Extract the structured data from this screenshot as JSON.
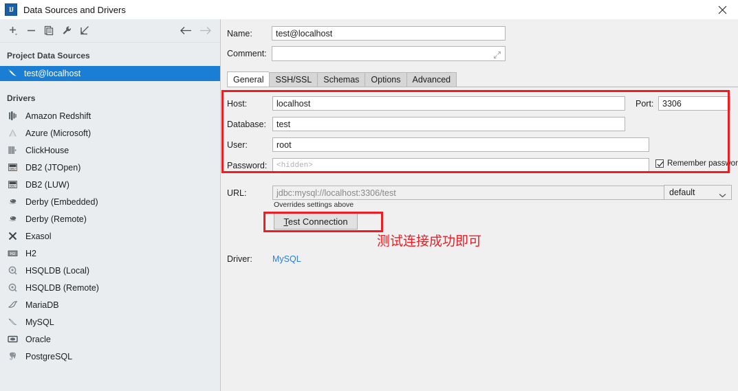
{
  "window": {
    "title": "Data Sources and Drivers",
    "app_icon": "intellij-idea-icon",
    "close_label": "×"
  },
  "toolbar": {
    "buttons": [
      {
        "name": "add-button",
        "icon": "plus-icon",
        "tooltip": "Add"
      },
      {
        "name": "remove-button",
        "icon": "minus-icon",
        "tooltip": "Remove"
      },
      {
        "name": "duplicate-button",
        "icon": "copy-icon",
        "tooltip": "Duplicate"
      },
      {
        "name": "properties-button",
        "icon": "wrench-icon",
        "tooltip": "Properties"
      },
      {
        "name": "import-button",
        "icon": "import-arrow-icon",
        "tooltip": "Import"
      }
    ],
    "back_label": "Back",
    "forward_label": "Forward"
  },
  "sidebar": {
    "project_sources_header": "Project Data Sources",
    "data_sources": [
      {
        "label": "test@localhost",
        "icon": "mysql-dolphin-icon",
        "selected": true
      }
    ],
    "drivers_header": "Drivers",
    "drivers": [
      {
        "label": "Amazon Redshift",
        "icon": "redshift-icon"
      },
      {
        "label": "Azure (Microsoft)",
        "icon": "azure-icon"
      },
      {
        "label": "ClickHouse",
        "icon": "clickhouse-icon"
      },
      {
        "label": "DB2 (JTOpen)",
        "icon": "db2-icon"
      },
      {
        "label": "DB2 (LUW)",
        "icon": "db2-icon"
      },
      {
        "label": "Derby (Embedded)",
        "icon": "derby-icon"
      },
      {
        "label": "Derby (Remote)",
        "icon": "derby-icon"
      },
      {
        "label": "Exasol",
        "icon": "exasol-icon"
      },
      {
        "label": "H2",
        "icon": "h2-icon"
      },
      {
        "label": "HSQLDB (Local)",
        "icon": "hsqldb-icon"
      },
      {
        "label": "HSQLDB (Remote)",
        "icon": "hsqldb-icon"
      },
      {
        "label": "MariaDB",
        "icon": "mariadb-icon"
      },
      {
        "label": "MySQL",
        "icon": "mysql-dolphin-icon"
      },
      {
        "label": "Oracle",
        "icon": "oracle-icon"
      },
      {
        "label": "PostgreSQL",
        "icon": "postgresql-elephant-icon"
      }
    ]
  },
  "form": {
    "name_label": "Name:",
    "name_value": "test@localhost",
    "comment_label": "Comment:",
    "comment_value": "",
    "tabs": [
      {
        "label": "General",
        "active": true
      },
      {
        "label": "SSH/SSL",
        "active": false
      },
      {
        "label": "Schemas",
        "active": false
      },
      {
        "label": "Options",
        "active": false
      },
      {
        "label": "Advanced",
        "active": false
      }
    ],
    "host_label": "Host:",
    "host_value": "localhost",
    "port_label": "Port:",
    "port_value": "3306",
    "database_label": "Database:",
    "database_value": "test",
    "user_label": "User:",
    "user_value": "root",
    "password_label": "Password:",
    "password_placeholder": "<hidden>",
    "remember_password_label": "Remember password",
    "remember_password_checked": true,
    "url_label": "URL:",
    "url_value": "jdbc:mysql://localhost:3306/test",
    "url_hint": "Overrides settings above",
    "url_mode_value": "default",
    "test_connection_label": "Test Connection",
    "test_connection_mnemonic": "T",
    "driver_label": "Driver:",
    "driver_value": "MySQL"
  },
  "annotations": {
    "accent_color": "#ee1c23",
    "note_text": "测试连接成功即可",
    "boxes": [
      "connection-fields-highlight",
      "test-connection-highlight"
    ]
  },
  "colors": {
    "selection_blue": "#1a7fd4",
    "link_blue": "#2e7dd1",
    "annotation_red": "#ee1c23",
    "panel_gray": "#f0f0f0",
    "sidebar_gray": "#e9edf0"
  }
}
